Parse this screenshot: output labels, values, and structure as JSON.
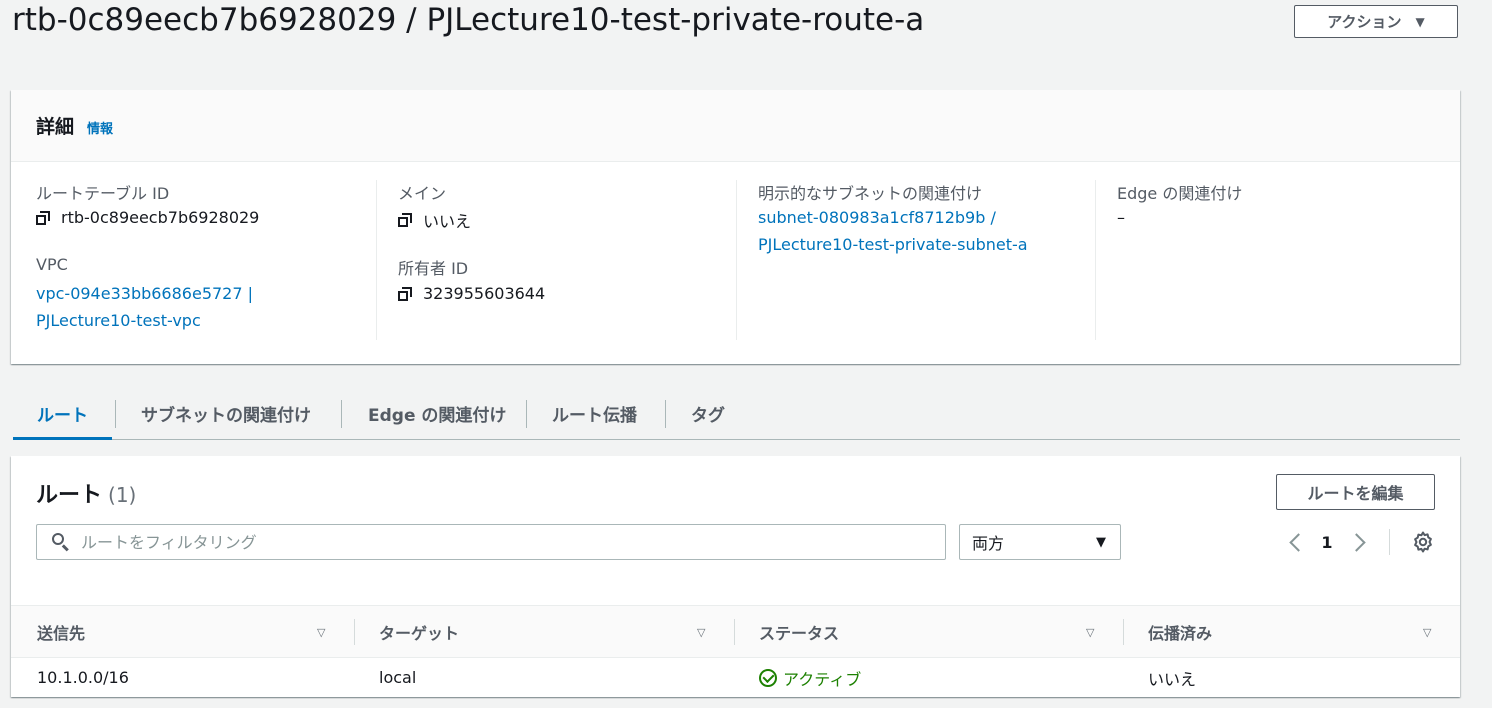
{
  "header": {
    "title": "rtb-0c89eecb7b6928029 / PJLecture10-test-private-route-a",
    "actions_label": "アクション"
  },
  "details": {
    "title": "詳細",
    "info_link": "情報",
    "route_table_id_label": "ルートテーブル ID",
    "route_table_id": "rtb-0c89eecb7b6928029",
    "vpc_label": "VPC",
    "vpc_line1": "vpc-094e33bb6686e5727 |",
    "vpc_line2": "PJLecture10-test-vpc",
    "main_label": "メイン",
    "main_value": "いいえ",
    "owner_label": "所有者 ID",
    "owner_value": "323955603644",
    "subnet_assoc_label": "明示的なサブネットの関連付け",
    "subnet_assoc_line1": "subnet-080983a1cf8712b9b /",
    "subnet_assoc_line2": "PJLecture10-test-private-subnet-a",
    "edge_assoc_label": "Edge の関連付け",
    "edge_assoc_value": "–"
  },
  "tabs": [
    {
      "label": "ルート",
      "active": true
    },
    {
      "label": "サブネットの関連付け",
      "active": false
    },
    {
      "label": "Edge の関連付け",
      "active": false
    },
    {
      "label": "ルート伝播",
      "active": false
    },
    {
      "label": "タグ",
      "active": false
    }
  ],
  "routes": {
    "title": "ルート",
    "count": "(1)",
    "edit_button": "ルートを編集",
    "filter_placeholder": "ルートをフィルタリング",
    "filter_select": "両方",
    "page": "1",
    "columns": [
      "送信先",
      "ターゲット",
      "ステータス",
      "伝播済み"
    ],
    "rows": [
      {
        "destination": "10.1.0.0/16",
        "target": "local",
        "status": "アクティブ",
        "propagated": "いいえ"
      }
    ]
  },
  "colors": {
    "link": "#0073bb",
    "success": "#1d8102",
    "background": "#f2f3f3"
  }
}
